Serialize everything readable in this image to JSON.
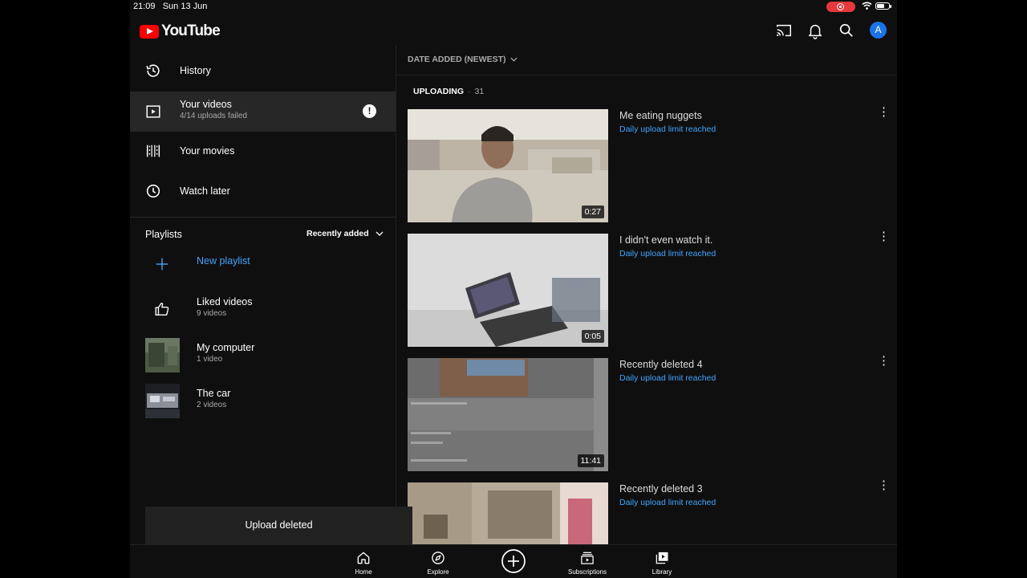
{
  "status_bar": {
    "time": "21:09",
    "date": "Sun 13 Jun"
  },
  "brand": {
    "name": "YouTube",
    "red": "#ff0000",
    "accent_blue": "#3ea6ff"
  },
  "topbar": {
    "icons": [
      "cast-icon",
      "bell-icon",
      "search-icon"
    ],
    "avatar_letter": "A"
  },
  "nav": {
    "history": "History",
    "your_videos": "Your videos",
    "your_videos_sub": "4/14 uploads failed",
    "alert": "!",
    "your_movies": "Your movies",
    "watch_later": "Watch later"
  },
  "playlists": {
    "heading": "Playlists",
    "sort_label": "Recently added",
    "new_playlist": "New playlist",
    "items": [
      {
        "title": "Liked videos",
        "sub": "9 videos"
      },
      {
        "title": "My computer",
        "sub": "1 video"
      },
      {
        "title": "The car",
        "sub": "2 videos"
      }
    ]
  },
  "snackbar": "Upload deleted",
  "videos_panel": {
    "sort": "DATE ADDED (NEWEST)",
    "section": "UPLOADING",
    "count": "31",
    "videos": [
      {
        "title": "Me eating nuggets",
        "status": "Daily upload limit reached",
        "duration": "0:27"
      },
      {
        "title": "I didn't even watch it.",
        "status": "Daily upload limit reached",
        "duration": "0:05"
      },
      {
        "title": "Recently deleted 4",
        "status": "Daily upload limit reached",
        "duration": "11:41"
      },
      {
        "title": "Recently deleted 3",
        "status": "Daily upload limit reached",
        "duration": ""
      }
    ]
  },
  "bottom_nav": [
    {
      "label": "Home",
      "icon": "home-icon"
    },
    {
      "label": "Explore",
      "icon": "compass-icon"
    },
    {
      "label": "",
      "icon": "create-icon"
    },
    {
      "label": "Subscriptions",
      "icon": "subscriptions-icon"
    },
    {
      "label": "Library",
      "icon": "library-icon"
    }
  ]
}
